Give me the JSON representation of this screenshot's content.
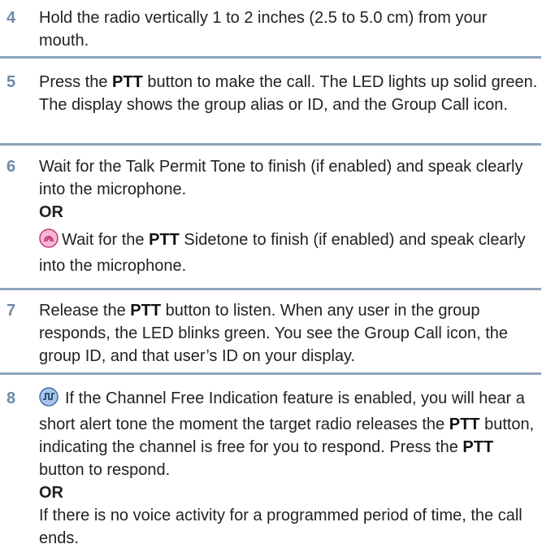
{
  "steps": [
    {
      "number": "4",
      "text": "Hold the radio vertically 1 to 2 inches (2.5 to 5.0 cm) from your mouth."
    },
    {
      "number": "5",
      "t1": "Press the ",
      "b1": "PTT",
      "t2": " button to make the call. The LED lights up solid green. The display shows the group alias or ID, and the Group Call icon."
    },
    {
      "number": "6",
      "line1": "Wait for the Talk Permit Tone to finish (if enabled) and speak clearly into the microphone.",
      "or_label": "OR",
      "icon": "ptt-sidetone-icon",
      "t1": "Wait for the ",
      "b1": "PTT",
      "t2": " Sidetone to finish (if enabled) and speak clearly into the microphone."
    },
    {
      "number": "7",
      "t1": "Release the ",
      "b1": "PTT",
      "t2": " button to listen. When any user in the group responds, the LED blinks green. You see the Group Call icon, the group ID, and that user’s ID on your display."
    },
    {
      "number": "8",
      "icon": "channel-free-indication-icon",
      "t1": "If the Channel Free Indication feature is enabled, you will hear a short alert tone the moment the target radio releases the ",
      "b1": "PTT",
      "t2": " button, indicating the channel is free for you to respond. Press the ",
      "b2": "PTT",
      "t3": " button to respond.",
      "or_label": "OR",
      "t4": "If there is no voice activity for a programmed period of time, the call ends."
    }
  ],
  "colors": {
    "step_number": "#6e8aa6",
    "divider": "#8ea4ba",
    "sidetone_icon": "#c2357a",
    "channel_icon": "#3f6fb0"
  }
}
